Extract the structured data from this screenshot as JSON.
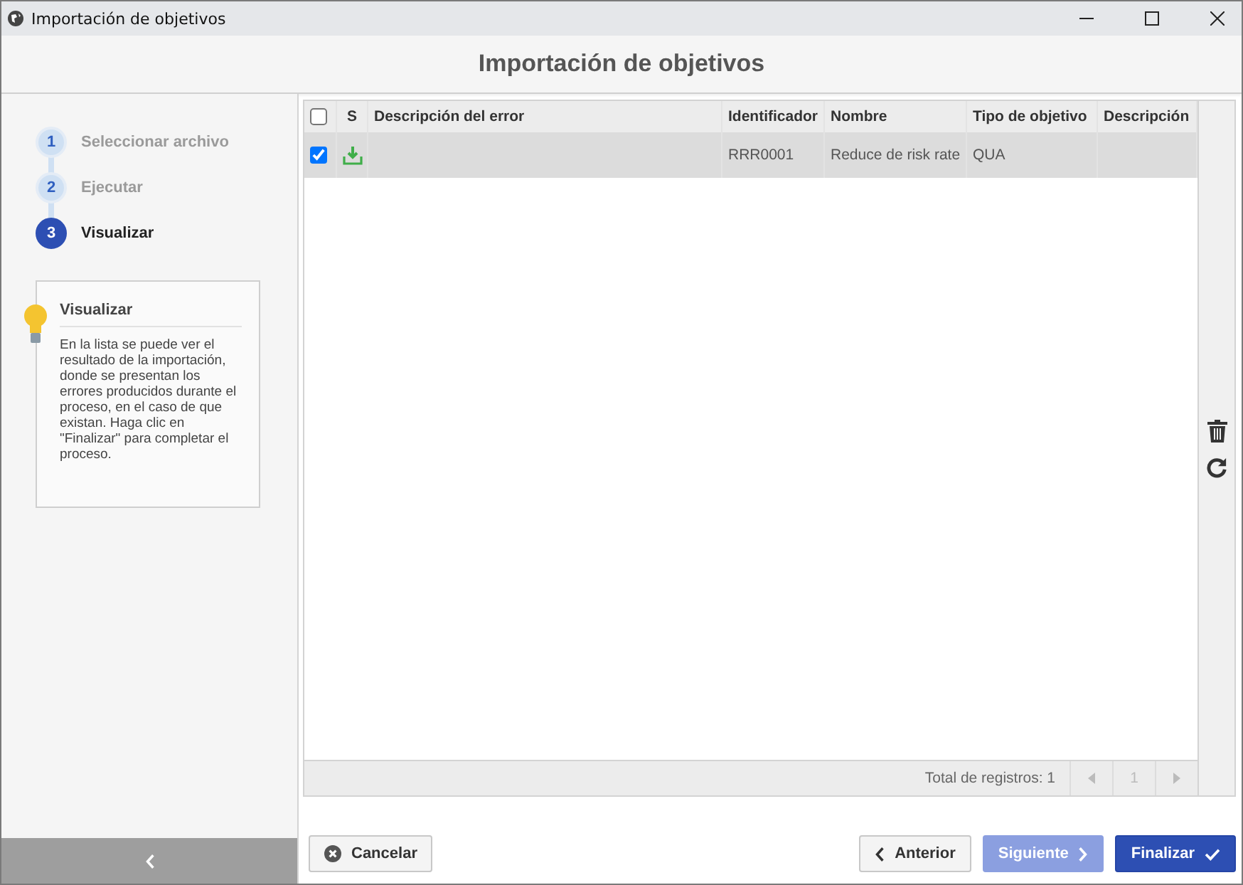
{
  "window": {
    "title": "Importación de objetivos"
  },
  "header": {
    "title": "Importación de objetivos"
  },
  "steps": [
    {
      "number": "1",
      "label": "Seleccionar archivo",
      "selected": false
    },
    {
      "number": "2",
      "label": "Ejecutar",
      "selected": false
    },
    {
      "number": "3",
      "label": "Visualizar",
      "selected": true
    }
  ],
  "help": {
    "title": "Visualizar",
    "text": "En la lista se puede ver el resultado de la importación, donde se presentan los errores producidos durante el proceso, en el caso de que existan. Haga clic en \"Finalizar\" para completar el proceso."
  },
  "table": {
    "select_all": false,
    "columns": [
      "S",
      "Descripción del error",
      "Identificador",
      "Nombre",
      "Tipo de objetivo",
      "Descripción"
    ],
    "rows": [
      {
        "checked": true,
        "selected": true,
        "cells": [
          "",
          "",
          "RRR0001",
          "Reduce de risk rate",
          "QUA",
          ""
        ]
      }
    ],
    "total": "Total de registros: 1",
    "page": "1"
  },
  "buttons": [
    {
      "label": "Cancelar",
      "kind": "cancel",
      "disabled": false
    },
    {
      "label": "Anterior",
      "kind": "back",
      "disabled": false
    },
    {
      "label": "Siguiente",
      "kind": "next",
      "disabled": true
    },
    {
      "label": "Finalizar",
      "kind": "finish",
      "disabled": false
    }
  ]
}
